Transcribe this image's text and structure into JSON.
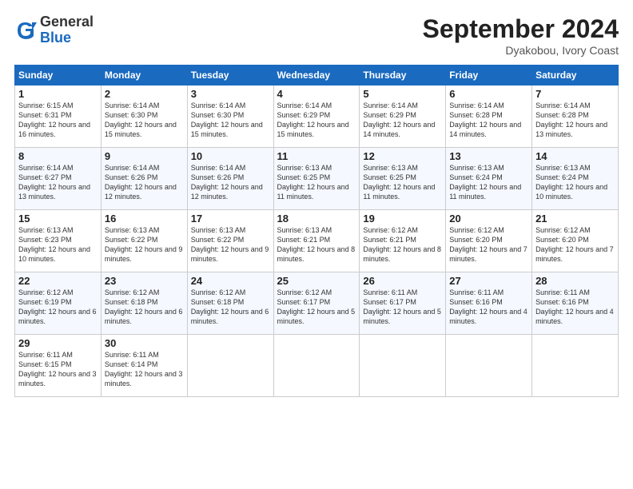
{
  "header": {
    "logo_general": "General",
    "logo_blue": "Blue",
    "month_title": "September 2024",
    "location": "Dyakobou, Ivory Coast"
  },
  "days_of_week": [
    "Sunday",
    "Monday",
    "Tuesday",
    "Wednesday",
    "Thursday",
    "Friday",
    "Saturday"
  ],
  "weeks": [
    [
      {
        "day": "1",
        "sunrise": "6:15 AM",
        "sunset": "6:31 PM",
        "daylight": "12 hours and 16 minutes."
      },
      {
        "day": "2",
        "sunrise": "6:14 AM",
        "sunset": "6:30 PM",
        "daylight": "12 hours and 15 minutes."
      },
      {
        "day": "3",
        "sunrise": "6:14 AM",
        "sunset": "6:30 PM",
        "daylight": "12 hours and 15 minutes."
      },
      {
        "day": "4",
        "sunrise": "6:14 AM",
        "sunset": "6:29 PM",
        "daylight": "12 hours and 15 minutes."
      },
      {
        "day": "5",
        "sunrise": "6:14 AM",
        "sunset": "6:29 PM",
        "daylight": "12 hours and 14 minutes."
      },
      {
        "day": "6",
        "sunrise": "6:14 AM",
        "sunset": "6:28 PM",
        "daylight": "12 hours and 14 minutes."
      },
      {
        "day": "7",
        "sunrise": "6:14 AM",
        "sunset": "6:28 PM",
        "daylight": "12 hours and 13 minutes."
      }
    ],
    [
      {
        "day": "8",
        "sunrise": "6:14 AM",
        "sunset": "6:27 PM",
        "daylight": "12 hours and 13 minutes."
      },
      {
        "day": "9",
        "sunrise": "6:14 AM",
        "sunset": "6:26 PM",
        "daylight": "12 hours and 12 minutes."
      },
      {
        "day": "10",
        "sunrise": "6:14 AM",
        "sunset": "6:26 PM",
        "daylight": "12 hours and 12 minutes."
      },
      {
        "day": "11",
        "sunrise": "6:13 AM",
        "sunset": "6:25 PM",
        "daylight": "12 hours and 11 minutes."
      },
      {
        "day": "12",
        "sunrise": "6:13 AM",
        "sunset": "6:25 PM",
        "daylight": "12 hours and 11 minutes."
      },
      {
        "day": "13",
        "sunrise": "6:13 AM",
        "sunset": "6:24 PM",
        "daylight": "12 hours and 11 minutes."
      },
      {
        "day": "14",
        "sunrise": "6:13 AM",
        "sunset": "6:24 PM",
        "daylight": "12 hours and 10 minutes."
      }
    ],
    [
      {
        "day": "15",
        "sunrise": "6:13 AM",
        "sunset": "6:23 PM",
        "daylight": "12 hours and 10 minutes."
      },
      {
        "day": "16",
        "sunrise": "6:13 AM",
        "sunset": "6:22 PM",
        "daylight": "12 hours and 9 minutes."
      },
      {
        "day": "17",
        "sunrise": "6:13 AM",
        "sunset": "6:22 PM",
        "daylight": "12 hours and 9 minutes."
      },
      {
        "day": "18",
        "sunrise": "6:13 AM",
        "sunset": "6:21 PM",
        "daylight": "12 hours and 8 minutes."
      },
      {
        "day": "19",
        "sunrise": "6:12 AM",
        "sunset": "6:21 PM",
        "daylight": "12 hours and 8 minutes."
      },
      {
        "day": "20",
        "sunrise": "6:12 AM",
        "sunset": "6:20 PM",
        "daylight": "12 hours and 7 minutes."
      },
      {
        "day": "21",
        "sunrise": "6:12 AM",
        "sunset": "6:20 PM",
        "daylight": "12 hours and 7 minutes."
      }
    ],
    [
      {
        "day": "22",
        "sunrise": "6:12 AM",
        "sunset": "6:19 PM",
        "daylight": "12 hours and 6 minutes."
      },
      {
        "day": "23",
        "sunrise": "6:12 AM",
        "sunset": "6:18 PM",
        "daylight": "12 hours and 6 minutes."
      },
      {
        "day": "24",
        "sunrise": "6:12 AM",
        "sunset": "6:18 PM",
        "daylight": "12 hours and 6 minutes."
      },
      {
        "day": "25",
        "sunrise": "6:12 AM",
        "sunset": "6:17 PM",
        "daylight": "12 hours and 5 minutes."
      },
      {
        "day": "26",
        "sunrise": "6:11 AM",
        "sunset": "6:17 PM",
        "daylight": "12 hours and 5 minutes."
      },
      {
        "day": "27",
        "sunrise": "6:11 AM",
        "sunset": "6:16 PM",
        "daylight": "12 hours and 4 minutes."
      },
      {
        "day": "28",
        "sunrise": "6:11 AM",
        "sunset": "6:16 PM",
        "daylight": "12 hours and 4 minutes."
      }
    ],
    [
      {
        "day": "29",
        "sunrise": "6:11 AM",
        "sunset": "6:15 PM",
        "daylight": "12 hours and 3 minutes."
      },
      {
        "day": "30",
        "sunrise": "6:11 AM",
        "sunset": "6:14 PM",
        "daylight": "12 hours and 3 minutes."
      },
      null,
      null,
      null,
      null,
      null
    ]
  ]
}
